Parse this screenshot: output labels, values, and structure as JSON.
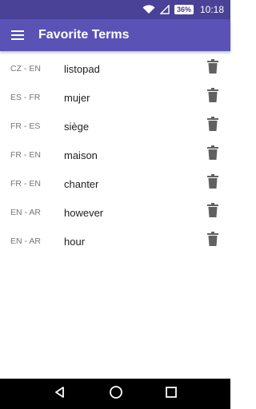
{
  "status_bar": {
    "battery": "36%",
    "time": "10:18"
  },
  "app_bar": {
    "title": "Favorite Terms"
  },
  "terms": [
    {
      "pair": "CZ - EN",
      "term": "listopad"
    },
    {
      "pair": "ES - FR",
      "term": "mujer"
    },
    {
      "pair": "FR - ES",
      "term": "siège"
    },
    {
      "pair": "FR - EN",
      "term": "maison"
    },
    {
      "pair": "FR - EN",
      "term": "chanter"
    },
    {
      "pair": "EN - AR",
      "term": "however"
    },
    {
      "pair": "EN - AR",
      "term": "hour"
    }
  ],
  "icons": {
    "menu": "hamburger-menu-icon",
    "delete": "trash-icon",
    "wifi": "wifi-icon",
    "signal": "signal-icon",
    "back": "back-icon",
    "home": "home-icon",
    "recents": "recents-icon"
  },
  "colors": {
    "status_bar": "#4a4296",
    "app_bar": "#5b52b6",
    "nav_bar": "#000000",
    "trash": "#616161"
  }
}
